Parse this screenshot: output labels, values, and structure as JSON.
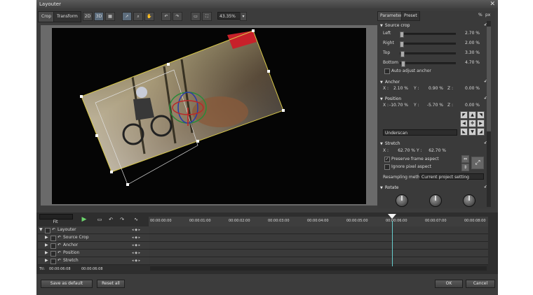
{
  "window": {
    "title": "Layouter",
    "close_glyph": "✕"
  },
  "toolbar": {
    "tab_crop": "Crop",
    "tab_transform": "Transform",
    "btn_2d": "2D",
    "btn_3d": "3D",
    "zoom_value": "43.35%"
  },
  "panel": {
    "tab_parameter": "Parameter",
    "tab_preset": "Preset",
    "unit_percent": "%",
    "unit_px": "px",
    "source_crop": {
      "title": "Source crop",
      "rows": [
        {
          "label": "Left",
          "value": "2.70 %",
          "fraction": 0.027
        },
        {
          "label": "Right",
          "value": "2.00 %",
          "fraction": 0.02
        },
        {
          "label": "Top",
          "value": "3.30 %",
          "fraction": 0.033
        },
        {
          "label": "Bottom",
          "value": "4.70 %",
          "fraction": 0.047
        }
      ],
      "auto_adjust_label": "Auto adjust anchor"
    },
    "anchor": {
      "title": "Anchor",
      "x_label": "X :",
      "x_value": "2.10 %",
      "y_label": "Y :",
      "y_value": "0.90 %",
      "z_label": "Z :",
      "z_value": "0.00 %"
    },
    "position": {
      "title": "Position",
      "x_label": "X :",
      "x_value": "-10.70 %",
      "y_label": "Y :",
      "y_value": "-5.70 %",
      "z_label": "Z :",
      "z_value": "0.00 %",
      "underscan": "Underscan"
    },
    "stretch": {
      "title": "Stretch",
      "x_label": "X :",
      "x_value": "62.70 %",
      "y_label": "Y :",
      "y_value": "62.70 %",
      "preserve_label": "Preserve frame aspect",
      "preserve_checked": true,
      "ignore_label": "Ignore pixel aspect",
      "ignore_checked": false,
      "resampling_label": "Resampling method",
      "resampling_value": "Current project setting"
    },
    "rotate": {
      "title": "Rotate"
    }
  },
  "timeline": {
    "fit_label": "Fit",
    "ruler": [
      "00:00:00:00",
      "00:00:01:00",
      "00:00:02:00",
      "00:00:03:00",
      "00:00:04:00",
      "00:00:05:00",
      "00:00:06:00",
      "00:00:07:00",
      "00:00:08:00"
    ],
    "tracks": [
      {
        "label": "Layouter"
      },
      {
        "label": "Source Crop"
      },
      {
        "label": "Anchor"
      },
      {
        "label": "Position"
      },
      {
        "label": "Stretch"
      }
    ],
    "ttl_label": "Ttl:",
    "ttl_value": "00:00:06:08",
    "cur_value": "00:00:06:08"
  },
  "footer": {
    "save_default": "Save as default",
    "reset_all": "Reset all",
    "ok": "OK",
    "cancel": "Cancel"
  },
  "colors": {
    "accent": "#5d6d7d",
    "playhead": "#66cccc",
    "play_green": "#6cd46c"
  }
}
